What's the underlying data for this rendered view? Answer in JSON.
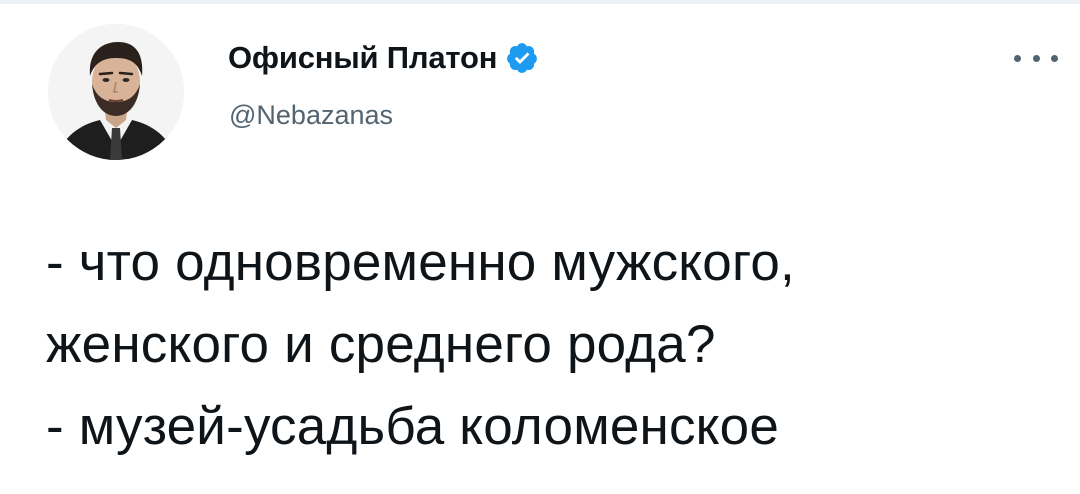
{
  "author": {
    "display_name": "Офисный Платон",
    "handle": "@Nebazanas",
    "verified": true,
    "avatar_icon": "profile-photo"
  },
  "menu": {
    "icon": "more-horizontal-icon"
  },
  "tweet": {
    "lines": [
      "- что одновременно мужского,",
      "женского и среднего рода?",
      "- музей-усадьба коломенское"
    ]
  },
  "colors": {
    "text": "#0f1419",
    "secondary_text": "#536471",
    "verified_badge": "#1d9bf0",
    "background": "#ffffff"
  }
}
